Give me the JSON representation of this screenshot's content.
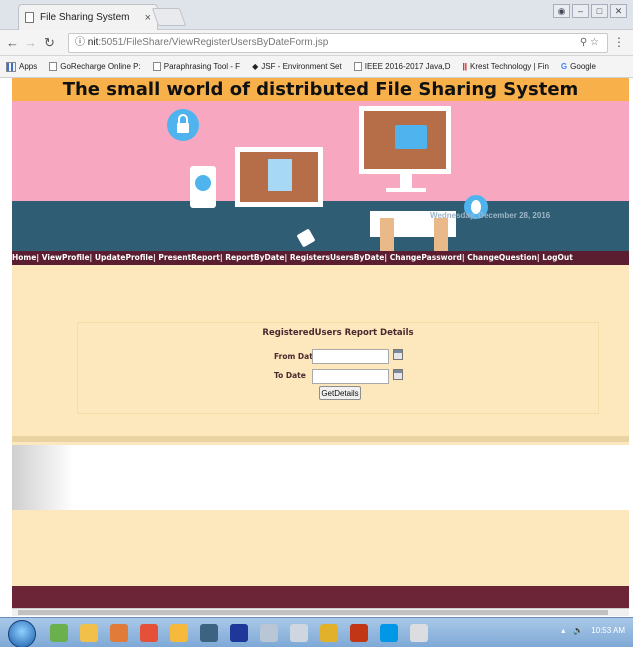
{
  "browser": {
    "tab_title": "File Sharing System",
    "tab_close": "×",
    "url_host": "nit",
    "url_path": ":5051/FileShare/ViewRegisterUsersByDateForm.jsp",
    "bookmarks": [
      "Apps",
      "GoRecharge Online P:",
      "Paraphrasing Tool - F",
      "JSF - Environment Set",
      "IEEE 2016-2017 Java,D",
      "Krest Technology | Fin",
      "Google"
    ]
  },
  "page": {
    "header_title": "The small world of distributed File Sharing System",
    "banner_date": "Wednesday, December 28, 2016",
    "nav": [
      "Home",
      "ViewProfile",
      "UpdateProfile",
      "PresentReport",
      "ReportByDate",
      "RegistersUsersByDate",
      "ChangePassword",
      "ChangeQuestion",
      "LogOut"
    ],
    "form": {
      "title": "RegisteredUsers Report Details",
      "from_label": "From Date",
      "to_label": "To Date",
      "from_value": "",
      "to_value": "",
      "button_label": "GetDetails"
    }
  },
  "taskbar": {
    "time": "10:53 AM"
  }
}
